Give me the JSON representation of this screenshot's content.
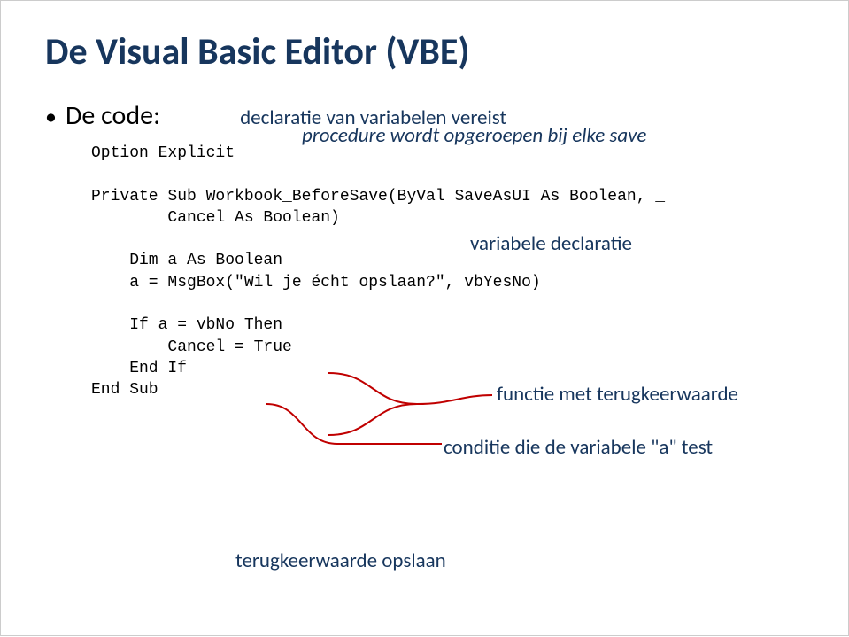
{
  "title": "De Visual Basic Editor (VBE)",
  "bullet_label": "De code:",
  "annot_declaration": "declaratie van variabelen vereist",
  "annot_procedure": "procedure wordt opgeroepen bij elke save",
  "annot_vardecl": "variabele declaratie",
  "annot_func": "functie met terugkeerwaarde",
  "annot_cond": "conditie die de variabele \"a\" test",
  "annot_retstore": "terugkeerwaarde opslaan",
  "code": {
    "l1": "Option Explicit",
    "l2": "",
    "l3": "Private Sub Workbook_BeforeSave(ByVal SaveAsUI As Boolean, _",
    "l4": "        Cancel As Boolean)",
    "l5": "",
    "l6": "    Dim a As Boolean",
    "l7": "    a = MsgBox(\"Wil je écht opslaan?\", vbYesNo)",
    "l8": "",
    "l9": "    If a = vbNo Then",
    "l10": "        Cancel = True",
    "l11": "    End If",
    "l12": "End Sub"
  }
}
